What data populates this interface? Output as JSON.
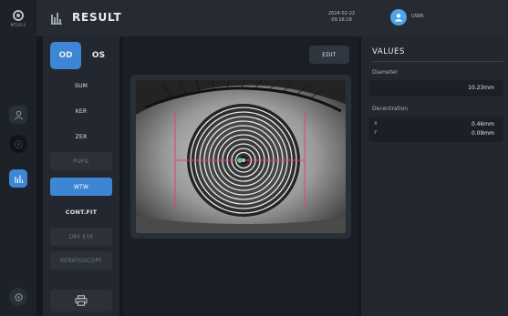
{
  "header": {
    "model_label": "MTGR-1",
    "title": "RESULT",
    "date": "2024-02-22",
    "time": "09:16:18",
    "user_name": "USER",
    "colors": {
      "bar": "#262b33",
      "accent": "#3d86d6",
      "user_avatar": "#4fa3e8"
    }
  },
  "rail": {
    "items": [
      {
        "name": "user-icon",
        "active": false
      },
      {
        "name": "measure-icon",
        "active": false
      },
      {
        "name": "result-icon",
        "active": true
      },
      {
        "name": "settings-icon",
        "active": false
      }
    ]
  },
  "eye_tabs": {
    "od": "OD",
    "os": "OS",
    "selected": "OD"
  },
  "menu": {
    "items": [
      {
        "label": "SUM",
        "state": "normal"
      },
      {
        "label": "KER",
        "state": "normal"
      },
      {
        "label": "ZER",
        "state": "normal"
      },
      {
        "label": "PUPIL",
        "state": "disabled"
      },
      {
        "label": "WTW",
        "state": "selected"
      },
      {
        "label": "CONT.FIT",
        "state": "normal"
      },
      {
        "label": "DRY EYE",
        "state": "disabled"
      },
      {
        "label": "KERATOSCOPY",
        "state": "disabled"
      }
    ],
    "print_icon": "printer-icon"
  },
  "viewer": {
    "edit_label": "EDIT",
    "overlay_color": "#e2457c",
    "marker_color": "#5ed26b"
  },
  "values": {
    "title": "VALUES",
    "diameter": {
      "label": "Diameter",
      "value": "10.23mm"
    },
    "decentration": {
      "label": "Decentration",
      "x_label": "X",
      "x_value": "0.46mm",
      "y_label": "Y",
      "y_value": "0.09mm"
    }
  }
}
